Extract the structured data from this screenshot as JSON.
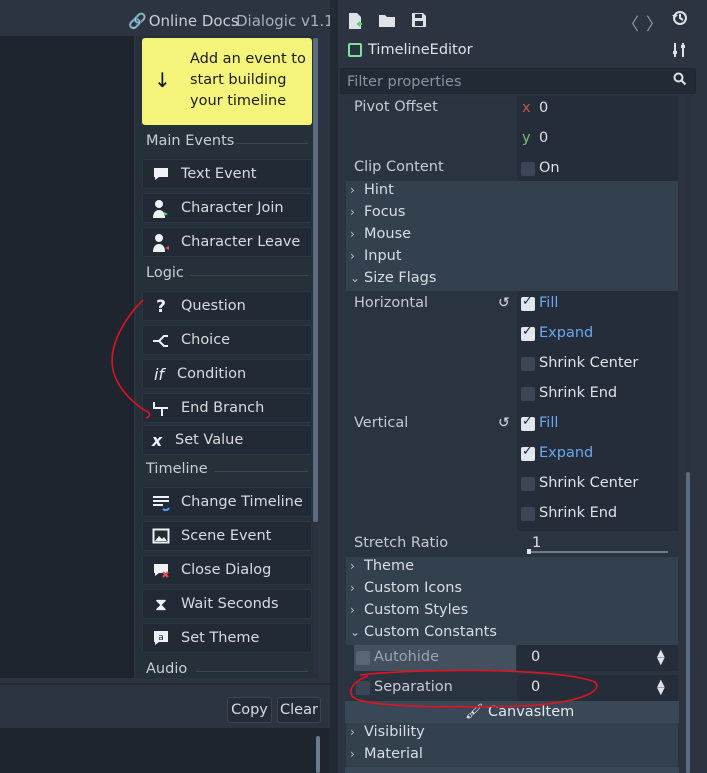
{
  "topbar": {
    "docs_label": "Online Docs",
    "version": "Dialogic v1.1"
  },
  "hint": {
    "text": "Add an event to start building your timeline"
  },
  "sections": {
    "main_events": "Main Events",
    "logic": "Logic",
    "timeline": "Timeline",
    "audio": "Audio"
  },
  "events": {
    "text_event": "Text Event",
    "character_join": "Character Join",
    "character_leave": "Character Leave",
    "question": "Question",
    "choice": "Choice",
    "condition": "Condition",
    "end_branch": "End Branch",
    "set_value": "Set Value",
    "change_timeline": "Change Timeline",
    "scene_event": "Scene Event",
    "close_dialog": "Close Dialog",
    "wait_seconds": "Wait Seconds",
    "set_theme": "Set Theme"
  },
  "output": {
    "copy_label": "Copy",
    "clear_label": "Clear"
  },
  "inspector": {
    "node_name": "TimelineEditor",
    "filter_placeholder": "Filter properties",
    "pivot_offset": {
      "label": "Pivot Offset",
      "x_label": "x",
      "x_value": "0",
      "y_label": "y",
      "y_value": "0"
    },
    "clip_content": {
      "label": "Clip Content",
      "value": "On"
    },
    "groups": {
      "hint": "Hint",
      "focus": "Focus",
      "mouse": "Mouse",
      "input": "Input",
      "size_flags": "Size Flags",
      "theme": "Theme",
      "custom_icons": "Custom Icons",
      "custom_styles": "Custom Styles",
      "custom_constants": "Custom Constants",
      "visibility": "Visibility",
      "material": "Material"
    },
    "horizontal": {
      "label": "Horizontal",
      "fill": "Fill",
      "expand": "Expand",
      "shrink_center": "Shrink Center",
      "shrink_end": "Shrink End"
    },
    "vertical": {
      "label": "Vertical",
      "fill": "Fill",
      "expand": "Expand",
      "shrink_center": "Shrink Center",
      "shrink_end": "Shrink End"
    },
    "stretch_ratio": {
      "label": "Stretch Ratio",
      "value": "1"
    },
    "autohide": {
      "label": "Autohide",
      "value": "0"
    },
    "separation": {
      "label": "Separation",
      "value": "0"
    },
    "canvas_item_label": "CanvasItem"
  },
  "colors": {
    "hint_background": "#f4f47a",
    "accent_blue": "#6aa9ef",
    "annotation_red": "#e0141e",
    "node_icon_green": "#7ee09a"
  }
}
